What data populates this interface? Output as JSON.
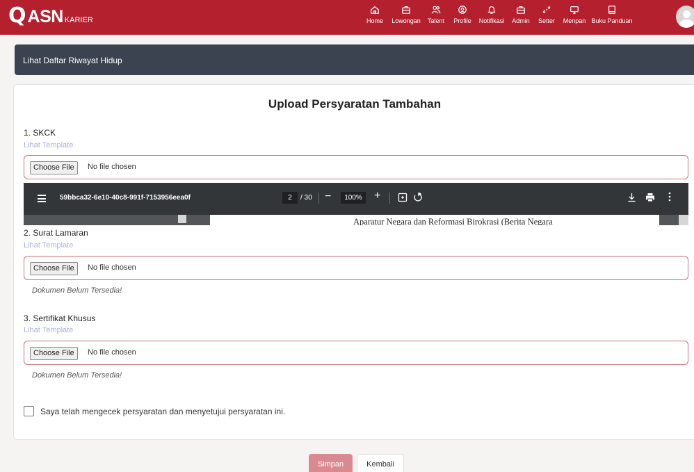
{
  "brand": {
    "q": "Q",
    "asn": "ASN",
    "karier": "KARIER"
  },
  "nav": [
    {
      "label": "Home",
      "icon": "home-icon"
    },
    {
      "label": "Lowongan",
      "icon": "briefcase-icon"
    },
    {
      "label": "Talent",
      "icon": "users-icon"
    },
    {
      "label": "Profile",
      "icon": "profile-icon"
    },
    {
      "label": "Notifikasi",
      "icon": "bell-icon"
    },
    {
      "label": "Admin",
      "icon": "briefcase-icon"
    },
    {
      "label": "Setter",
      "icon": "link-icon"
    },
    {
      "label": "Menpan",
      "icon": "monitor-icon"
    },
    {
      "label": "Buku Panduan",
      "icon": "book-icon"
    }
  ],
  "header_bar": {
    "link": "Lihat Daftar Riwayat Hidup"
  },
  "form": {
    "title": "Upload Persyaratan Tambahan",
    "items": [
      {
        "label": "1. SKCK",
        "template_link": "Lihat Template",
        "choose_label": "Choose File",
        "file_status": "No file chosen"
      },
      {
        "label": "2. Surat Lamaran",
        "template_link": "Lihat Template",
        "choose_label": "Choose File",
        "file_status": "No file chosen",
        "note": "Dokumen Belum Tersedia!"
      },
      {
        "label": "3. Sertifikat Khusus",
        "template_link": "Lihat Template",
        "choose_label": "Choose File",
        "file_status": "No file chosen",
        "note": "Dokumen Belum Tersedia!"
      }
    ],
    "agree_text": "Saya telah mengecek persyaratan dan menyetujui persyaratan ini.",
    "save_label": "Simpan",
    "back_label": "Kembali"
  },
  "pdf_viewer": {
    "file_name": "59bbca32-6e10-40c8-991f-7153956eea0f",
    "page": "2",
    "total": "/ 30",
    "zoom": "100%",
    "visible_text": "Aparatur Negara dan Reformasi Birokrasi (Berita Negara"
  },
  "colors": {
    "brand": "#b5202e",
    "dark_bar": "#3b4350",
    "save_button": "#d98a90",
    "pdf_toolbar": "#323639"
  }
}
